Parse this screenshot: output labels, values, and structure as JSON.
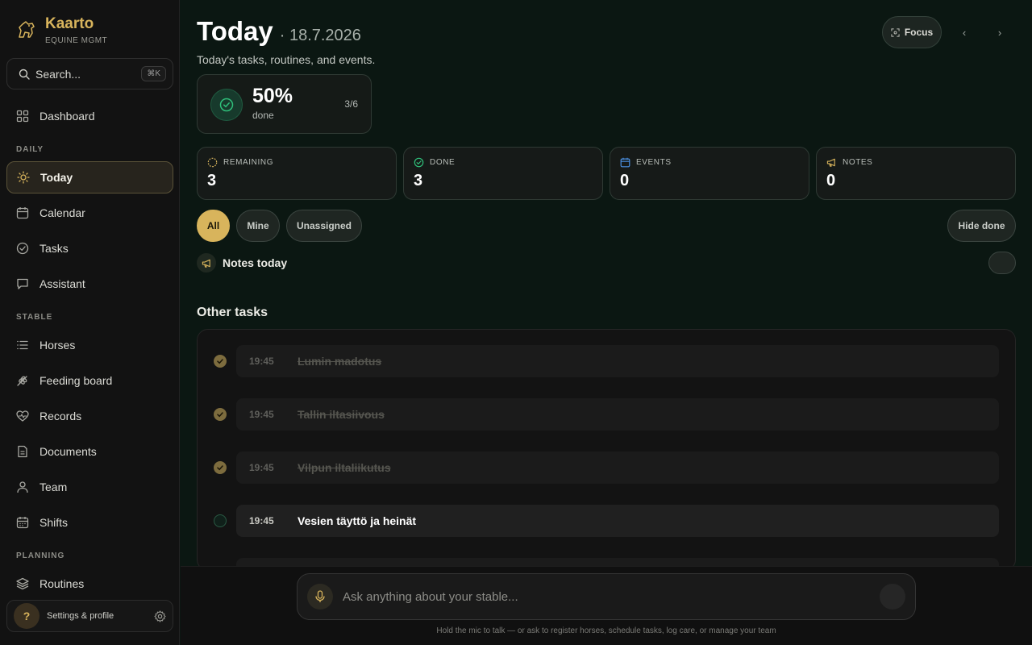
{
  "brand": {
    "name": "Kaarto",
    "subtitle": "EQUINE MGMT"
  },
  "search": {
    "label": "Search...",
    "shortcut": "⌘K"
  },
  "sidebar": {
    "dashboard": "Dashboard",
    "section_daily": "DAILY",
    "today": "Today",
    "calendar": "Calendar",
    "tasks": "Tasks",
    "assistant": "Assistant",
    "section_stable": "STABLE",
    "horses": "Horses",
    "feeding": "Feeding board",
    "records": "Records",
    "documents": "Documents",
    "team": "Team",
    "shifts": "Shifts",
    "section_planning": "PLANNING",
    "routines": "Routines"
  },
  "profile": {
    "avatar": "?",
    "label": "Settings & profile"
  },
  "header": {
    "title": "Today",
    "date": "· 18.7.2026",
    "subtitle": "Today's tasks, routines, and events.",
    "focus": "Focus",
    "prev": "‹",
    "next": "›"
  },
  "progress": {
    "percent": "50%",
    "label": "done",
    "count": "3/6"
  },
  "stats": {
    "remaining": {
      "label": "REMAINING",
      "value": "3"
    },
    "done": {
      "label": "DONE",
      "value": "3"
    },
    "events": {
      "label": "EVENTS",
      "value": "0"
    },
    "notes": {
      "label": "NOTES",
      "value": "0"
    }
  },
  "filters": {
    "all": "All",
    "mine": "Mine",
    "unassigned": "Unassigned",
    "hide_done": "Hide done"
  },
  "notes_today": "Notes today",
  "section_title": "Other tasks",
  "tasks": [
    {
      "time": "19:45",
      "name": "Lumin madotus",
      "done": true
    },
    {
      "time": "19:45",
      "name": "Tallin iltasiivous",
      "done": true
    },
    {
      "time": "19:45",
      "name": "Vilpun iltaliikutus",
      "done": true
    },
    {
      "time": "19:45",
      "name": "Vesien täyttö ja heinät",
      "done": false
    }
  ],
  "assistant_bar": {
    "placeholder": "Ask anything about your stable...",
    "hint": "Hold the mic to talk — or ask to register horses, schedule tasks, log care, or manage your team"
  },
  "colors": {
    "accent": "#d8b45c",
    "success": "#2fbf7a",
    "event": "#4a8fe0",
    "background": "#0b1712"
  }
}
